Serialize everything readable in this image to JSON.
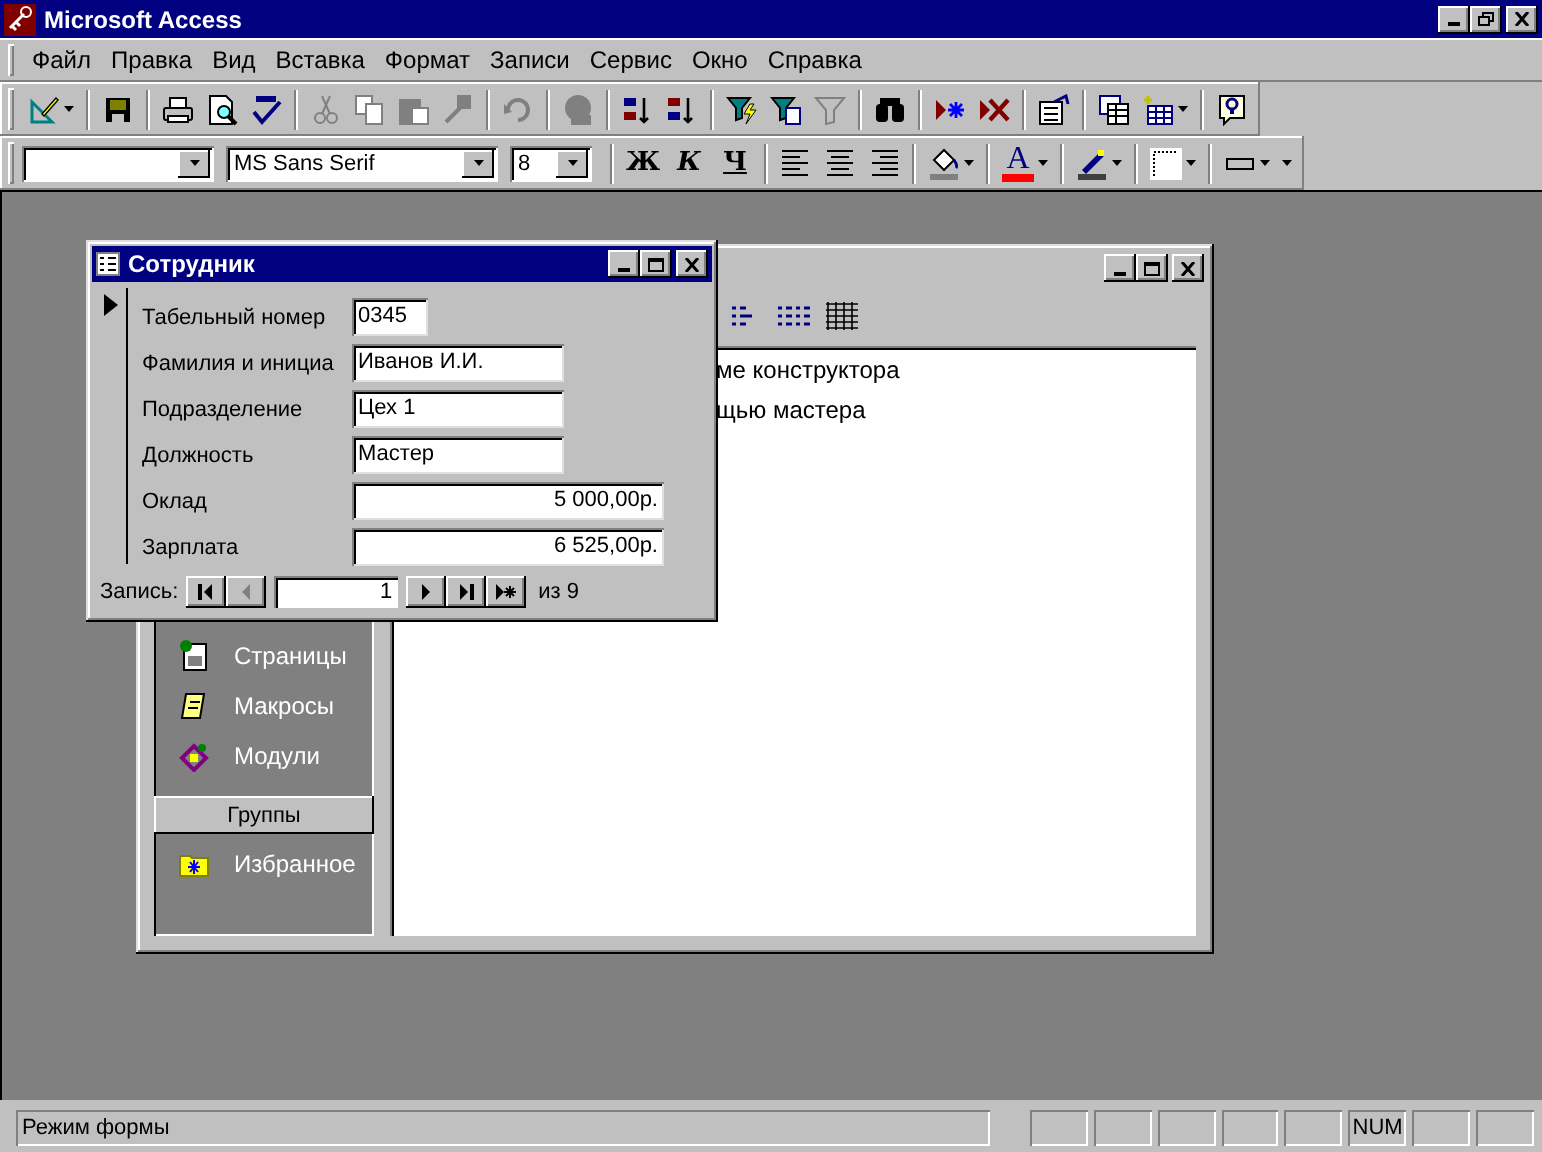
{
  "window": {
    "title": "Microsoft Access"
  },
  "menu": [
    {
      "label": "Файл"
    },
    {
      "label": "Правка"
    },
    {
      "label": "Вид"
    },
    {
      "label": "Вставка"
    },
    {
      "label": "Формат"
    },
    {
      "label": "Записи"
    },
    {
      "label": "Сервис"
    },
    {
      "label": "Окно"
    },
    {
      "label": "Справка"
    }
  ],
  "toolbar": {
    "groups": [
      {
        "buttons": [
          {
            "kind": "view",
            "disabled": false,
            "dropdown": true
          }
        ]
      },
      {
        "buttons": [
          {
            "kind": "save",
            "disabled": false,
            "dropdown": false
          }
        ]
      },
      {
        "buttons": [
          {
            "kind": "print",
            "disabled": false,
            "dropdown": false
          },
          {
            "kind": "preview",
            "disabled": false,
            "dropdown": false
          },
          {
            "kind": "spelling",
            "disabled": false,
            "dropdown": false
          }
        ]
      },
      {
        "buttons": [
          {
            "kind": "cut",
            "disabled": true,
            "dropdown": false
          },
          {
            "kind": "copy",
            "disabled": true,
            "dropdown": false
          },
          {
            "kind": "paste",
            "disabled": true,
            "dropdown": false
          },
          {
            "kind": "painter",
            "disabled": true,
            "dropdown": false
          }
        ]
      },
      {
        "buttons": [
          {
            "kind": "undo",
            "disabled": true,
            "dropdown": false
          }
        ]
      },
      {
        "buttons": [
          {
            "kind": "web",
            "disabled": true,
            "dropdown": false
          }
        ]
      },
      {
        "buttons": [
          {
            "kind": "sort_asc",
            "disabled": false,
            "dropdown": false
          },
          {
            "kind": "sort_desc",
            "disabled": false,
            "dropdown": false
          }
        ]
      },
      {
        "buttons": [
          {
            "kind": "filter_selection",
            "disabled": false,
            "dropdown": false
          },
          {
            "kind": "filter_form",
            "disabled": false,
            "dropdown": false
          },
          {
            "kind": "filter",
            "disabled": true,
            "dropdown": false
          }
        ]
      },
      {
        "buttons": [
          {
            "kind": "find",
            "disabled": false,
            "dropdown": false
          }
        ]
      },
      {
        "buttons": [
          {
            "kind": "new_record",
            "disabled": false,
            "dropdown": false
          },
          {
            "kind": "delete_record",
            "disabled": false,
            "dropdown": false
          }
        ]
      },
      {
        "buttons": [
          {
            "kind": "properties",
            "disabled": false,
            "dropdown": false
          }
        ]
      },
      {
        "buttons": [
          {
            "kind": "database",
            "disabled": false,
            "dropdown": false
          },
          {
            "kind": "new_object",
            "disabled": false,
            "dropdown": true
          }
        ]
      },
      {
        "buttons": [
          {
            "kind": "help",
            "disabled": false,
            "dropdown": false
          }
        ]
      }
    ]
  },
  "format_toolbar": {
    "font": "MS Sans Serif",
    "size": "8",
    "style_buttons": [
      {
        "kind": "bold",
        "label": "Ж"
      },
      {
        "kind": "italic",
        "label": "К"
      },
      {
        "kind": "underline",
        "label": "Ч"
      }
    ],
    "font_color_glyph": "A"
  },
  "database_window": {
    "list_items": [
      "ме конструктора",
      "щью мастера"
    ],
    "objects": [
      {
        "kind": "pages",
        "label": "Страницы"
      },
      {
        "kind": "macros",
        "label": "Макросы"
      },
      {
        "kind": "modules",
        "label": "Модули"
      }
    ],
    "groups_button": "Группы",
    "groups": [
      {
        "kind": "favorites",
        "label": "Избранное"
      }
    ]
  },
  "form_window": {
    "title": "Сотрудник",
    "current_record": true,
    "fields": [
      {
        "label": "Табельный номер",
        "value": "0345",
        "kind": "short"
      },
      {
        "label": "Фамилия и инициа",
        "value": "Иванов И.И.",
        "kind": "text"
      },
      {
        "label": "Подразделение",
        "value": "Цех 1",
        "kind": "text"
      },
      {
        "label": "Должность",
        "value": "Мастер",
        "kind": "text"
      },
      {
        "label": "Оклад",
        "value": "5 000,00р.",
        "kind": "currency"
      },
      {
        "label": "Зарплата",
        "value": "6 525,00р.",
        "kind": "currency"
      }
    ],
    "navigator": {
      "label": "Запись:",
      "buttons_before": [
        {
          "kind": "first",
          "disabled": false
        },
        {
          "kind": "prev",
          "disabled": true
        }
      ],
      "record": "1",
      "buttons_after": [
        {
          "kind": "next",
          "disabled": false
        },
        {
          "kind": "last",
          "disabled": false
        },
        {
          "kind": "new",
          "disabled": false
        }
      ],
      "of_label": "из",
      "total": "9"
    }
  },
  "status_bar": {
    "text": "Режим формы",
    "num_indicator": "NUM"
  }
}
